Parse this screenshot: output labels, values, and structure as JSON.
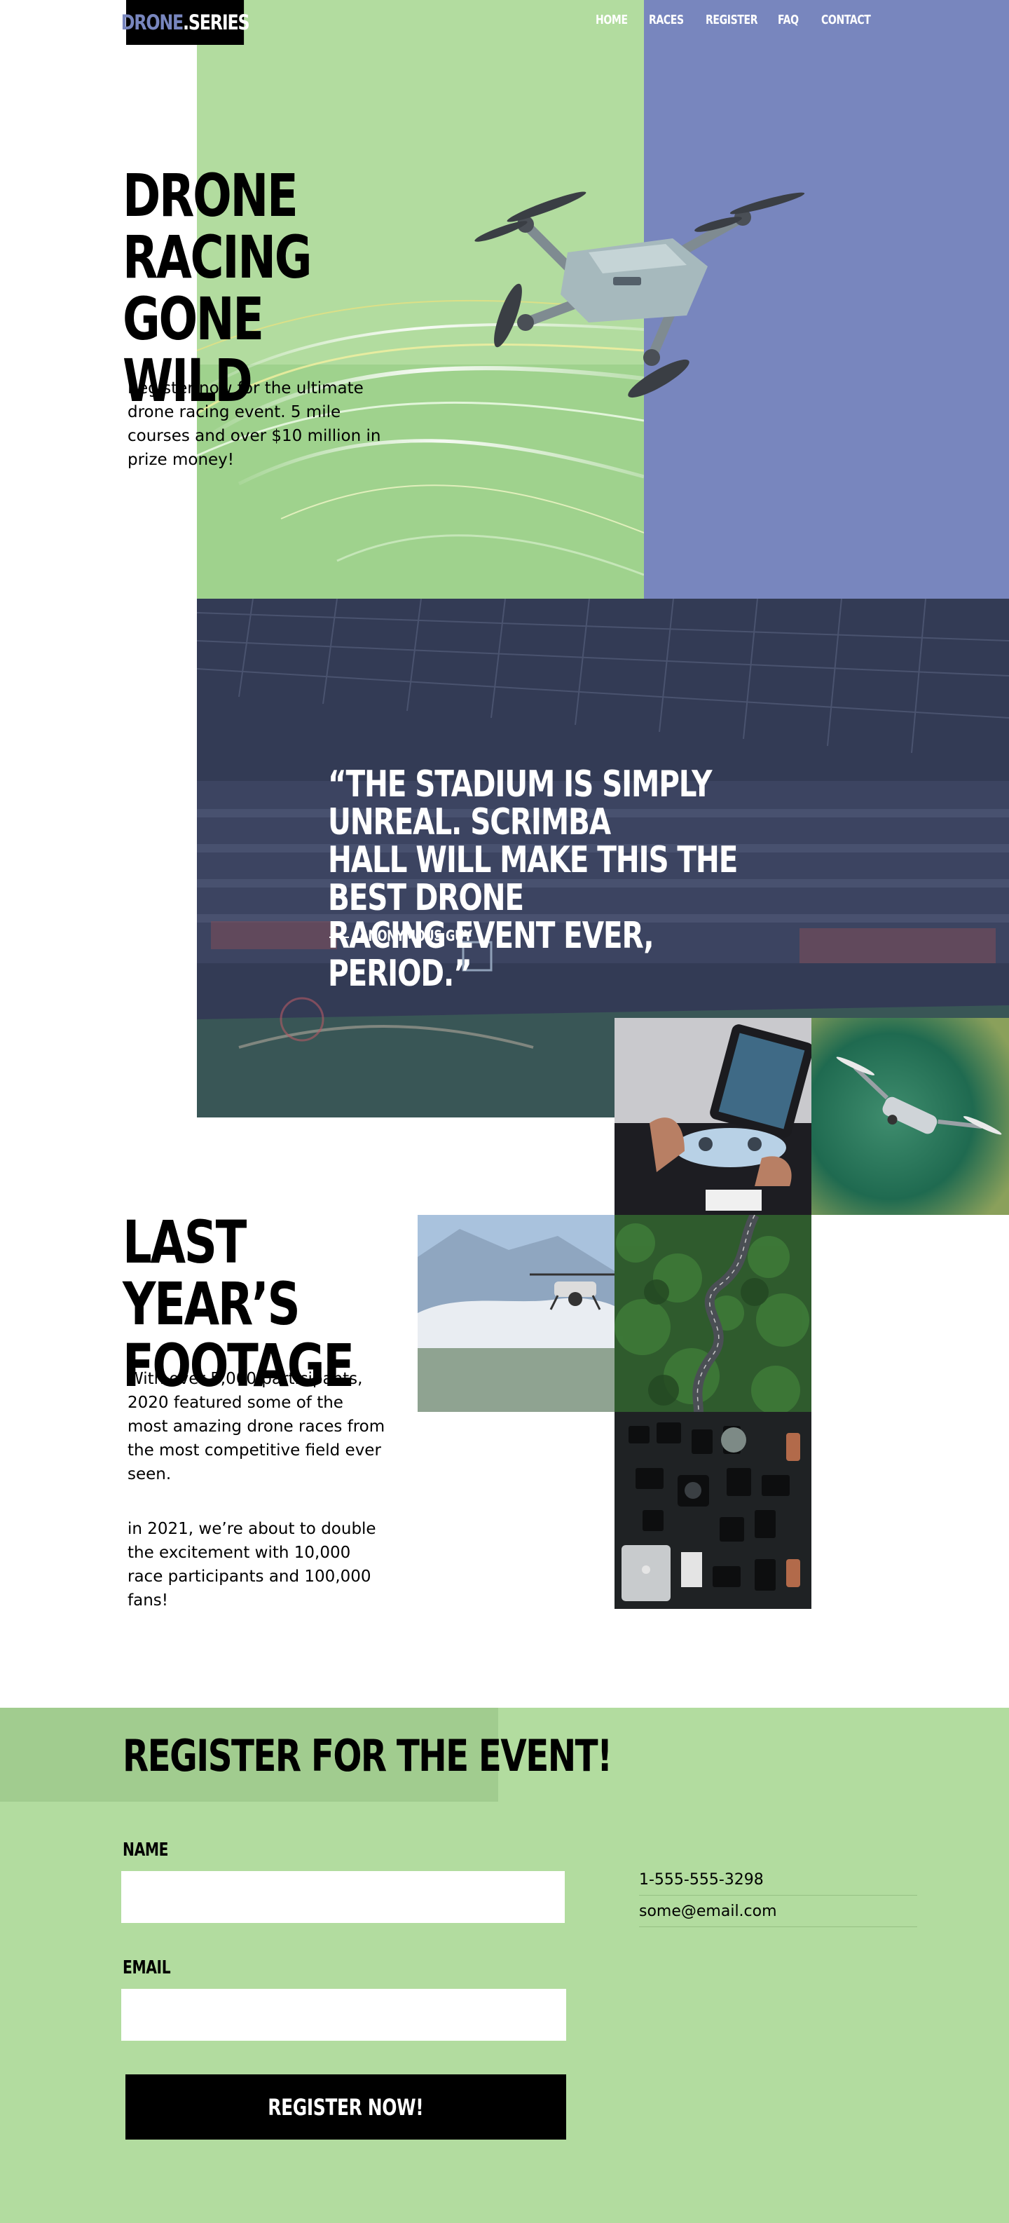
{
  "header": {
    "logo_part1": "DRONE",
    "logo_part2": ".SERIES",
    "nav": [
      "HOME",
      "RACES",
      "REGISTER",
      "FAQ",
      "CONTACT"
    ]
  },
  "hero": {
    "title_lines": [
      "DRONE",
      "RACING GONE",
      "WILD"
    ],
    "text": "Register now for the ultimate drone racing event. 5 mile courses and over $10 million in prize money!"
  },
  "testimonial": {
    "quote_lines": [
      "“THE STADIUM IS SIMPLY UNREAL. SCRIMBA",
      "HALL WILL MAKE THIS THE BEST DRONE",
      "RACING EVENT EVER, PERIOD.”"
    ],
    "author": "ANONYMOUS GUY"
  },
  "footage": {
    "title_lines": [
      "LAST YEAR’S",
      "FOOTAGE"
    ],
    "paragraph1": "With over 5,000 participants, 2020 featured some of the most amazing drone races from the most competitive field ever seen.",
    "paragraph2": "in 2021, we’re about to double the excitement with 10,000 race participants and 100,000 fans!"
  },
  "register": {
    "title": "REGISTER FOR THE EVENT!",
    "name_label": "NAME",
    "name_value": "",
    "email_label": "EMAIL",
    "email_value": "",
    "button_label": "REGISTER NOW!",
    "phone": "1-555-555-3298",
    "email_contact": "some@email.com"
  },
  "colors": {
    "green": "#b2dc9f",
    "green_dark": "#a1cc8f",
    "blue": "#7886be",
    "navy": "#333b55",
    "black": "#000000"
  }
}
